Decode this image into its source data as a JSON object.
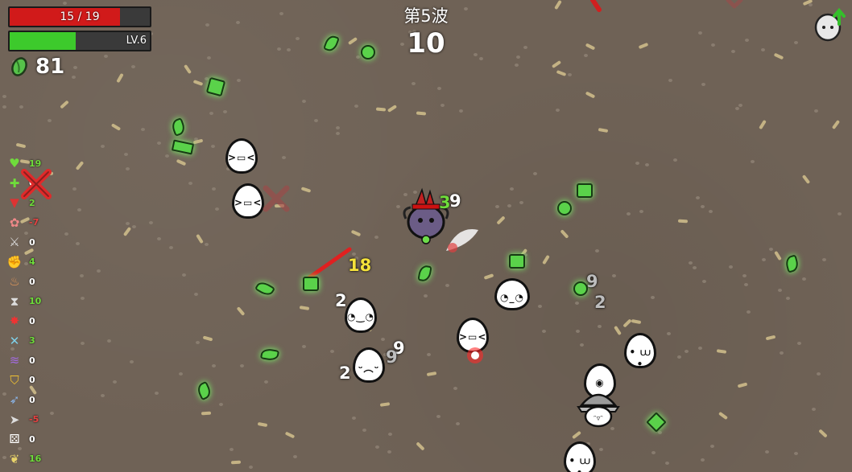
{
  "hud": {
    "health_text": "15 / 19",
    "health_fraction": 0.789,
    "health_color": "#d11a1a",
    "xp_text": "LV.6",
    "xp_fraction": 0.47,
    "xp_color": "#3dca2c",
    "materials": "81",
    "wave_title": "第5波",
    "timer": "10"
  },
  "stats": [
    {
      "icon": "heart-icon",
      "value": "19",
      "sign": "pos"
    },
    {
      "icon": "regen-heart-icon",
      "value": "0",
      "sign": "zero"
    },
    {
      "icon": "lifesteal-fangs-icon",
      "value": "2",
      "sign": "pos"
    },
    {
      "icon": "brain-icon",
      "value": "-7",
      "sign": "neg"
    },
    {
      "icon": "sword-icon",
      "value": "0",
      "sign": "zero"
    },
    {
      "icon": "flex-arm-icon",
      "value": "4",
      "sign": "pos"
    },
    {
      "icon": "fire-drop-icon",
      "value": "0",
      "sign": "zero"
    },
    {
      "icon": "hourglass-icon",
      "value": "10",
      "sign": "pos"
    },
    {
      "icon": "crit-star-icon",
      "value": "0",
      "sign": "zero"
    },
    {
      "icon": "crossed-weapons-icon",
      "value": "3",
      "sign": "pos"
    },
    {
      "icon": "range-wave-icon",
      "value": "0",
      "sign": "zero"
    },
    {
      "icon": "shield-icon",
      "value": "0",
      "sign": "zero"
    },
    {
      "icon": "dodge-wind-icon",
      "value": "0",
      "sign": "zero"
    },
    {
      "icon": "speed-boot-icon",
      "value": "-5",
      "sign": "neg"
    },
    {
      "icon": "luck-dice-icon",
      "value": "0",
      "sign": "zero"
    },
    {
      "icon": "harvest-wheat-icon",
      "value": "16",
      "sign": "pos"
    }
  ],
  "damage_numbers": [
    "3",
    "9",
    "18",
    "2",
    "9",
    "9",
    "2",
    "2",
    "9",
    "2"
  ],
  "colors": {
    "ground": "#6f6256",
    "material": "#5ad24a",
    "crit": "#f5e23b"
  }
}
